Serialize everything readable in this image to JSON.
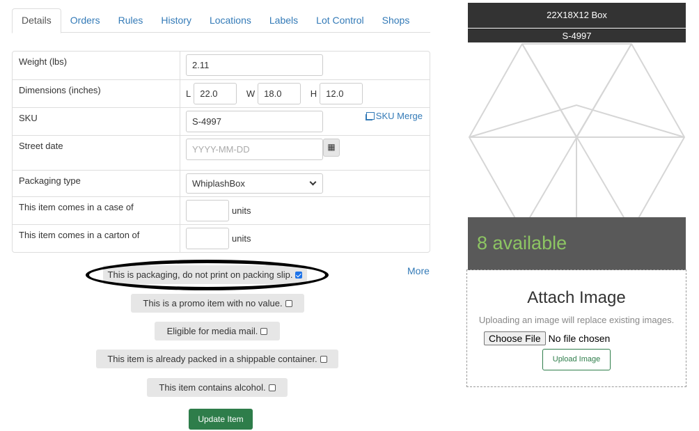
{
  "tabs": [
    "Details",
    "Orders",
    "Rules",
    "History",
    "Locations",
    "Labels",
    "Lot Control",
    "Shops"
  ],
  "fields": {
    "weight": {
      "label": "Weight (lbs)",
      "value": "2.11"
    },
    "dimensions": {
      "label": "Dimensions (inches)",
      "l_label": "L",
      "l": "22.0",
      "w_label": "W",
      "w": "18.0",
      "h_label": "H",
      "h": "12.0"
    },
    "sku": {
      "label": "SKU",
      "value": "S-4997",
      "merge_link": "SKU Merge"
    },
    "street_date": {
      "label": "Street date",
      "placeholder": "YYYY-MM-DD"
    },
    "packaging_type": {
      "label": "Packaging type",
      "value": "WhiplashBox"
    },
    "case_of": {
      "label": "This item comes in a case of",
      "units": "units"
    },
    "carton_of": {
      "label": "This item comes in a carton of",
      "units": "units"
    }
  },
  "more_link": "More",
  "checkboxes": [
    {
      "label": "This is packaging, do not print on packing slip.",
      "checked": true
    },
    {
      "label": "This is a promo item with no value.",
      "checked": false
    },
    {
      "label": "Eligible for media mail.",
      "checked": false
    },
    {
      "label": "This item is already packed in a shippable container.",
      "checked": false
    },
    {
      "label": "This item contains alcohol.",
      "checked": false
    }
  ],
  "update_button": "Update Item",
  "preview": {
    "title": "22X18X12 Box",
    "sku": "S-4997",
    "available": "8 available"
  },
  "attach": {
    "title": "Attach Image",
    "note": "Uploading an image will replace existing images.",
    "choose_file": "Choose File",
    "no_file": "No file chosen",
    "upload_button": "Upload Image"
  },
  "colors": {
    "link": "#337ab7",
    "primary_green": "#2e7d4a",
    "available_text": "#8dc563",
    "dark_header": "#333333"
  }
}
